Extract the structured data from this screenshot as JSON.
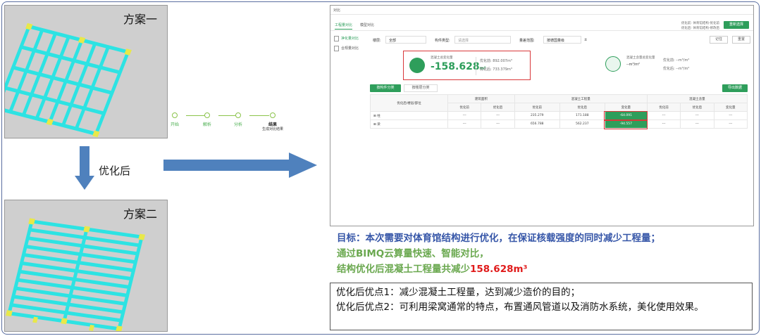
{
  "scheme1": {
    "title": "方案一"
  },
  "scheme2": {
    "title": "方案二"
  },
  "arrow_label": "优化后",
  "steps": [
    {
      "label": "开始"
    },
    {
      "label": "解析"
    },
    {
      "label": "分析"
    },
    {
      "label": "结果",
      "sub": "生成对比结果"
    }
  ],
  "app": {
    "window_title": "对比",
    "tabs": [
      "工程量对比",
      "模型对比"
    ],
    "info_lines": [
      "优化前: 体育馆结构-优化前",
      "优化后: 体育馆结构-修改后"
    ],
    "reselect_button": "重新选择",
    "sidebar": [
      "净化量对比",
      "合规量对比"
    ],
    "filters": {
      "floor_label": "楼层:",
      "floor_value": "全部",
      "type_label": "构件类型:",
      "type_value": "请选择",
      "range_label": "量差范围:",
      "range_value": "按德国量级",
      "range_sep": "±"
    },
    "record_button": "记住",
    "reset_button": "重置",
    "card_concrete": {
      "title": "混凝土总变化量",
      "value": "-158.628",
      "unit": "m³",
      "before": "优化前: 892.007m³",
      "after": "优化后: 733.379m³"
    },
    "card_content": {
      "title": "混凝土含量总变化量",
      "value": "--m³/m²",
      "before": "优化前: --m³/m²",
      "after": "优化后: --m³/m²"
    },
    "subtabs": [
      "按构件分类",
      "按楼层分类"
    ],
    "export_button": "导出数据",
    "table": {
      "group_headers": [
        "建筑面积",
        "混凝土工程量",
        "混凝土含量"
      ],
      "row_header": "优化后/楼层/部位",
      "sub_headers": [
        "优化前",
        "优化后",
        "优化前",
        "优化后",
        "变化量",
        "优化前",
        "优化后",
        "变化量"
      ],
      "rows": [
        {
          "name": "柱",
          "cells": [
            "---",
            "---",
            "235.279",
            "171.188",
            "-64.091",
            "---",
            "---",
            "---"
          ]
        },
        {
          "name": "梁",
          "cells": [
            "---",
            "---",
            "656.788",
            "562.237",
            "-94.557",
            "---",
            "---",
            "---"
          ]
        }
      ]
    }
  },
  "goal": {
    "line1": "目标：本次需要对体育馆结构进行优化，在保证核载强度的同时减少工程量；",
    "line2": "通过BIMQ云算量快速、智能对比，",
    "line3_prefix": "结构优化后混凝土工程量共减少",
    "line3_value": "158.628m³"
  },
  "notes": {
    "line1": "优化后优点1：减少混凝土工程量，达到减少造价的目的；",
    "line2": "优化后优点2：可利用梁窝通常的特点，布置通风管道以及消防水系统，美化使用效果。"
  },
  "colors": {
    "accent_green": "#2e9e5b",
    "highlight_red": "#d9383a",
    "goal_blue": "#3656a8",
    "goal_green": "#6aa84f",
    "value_red": "#e01b1b"
  }
}
